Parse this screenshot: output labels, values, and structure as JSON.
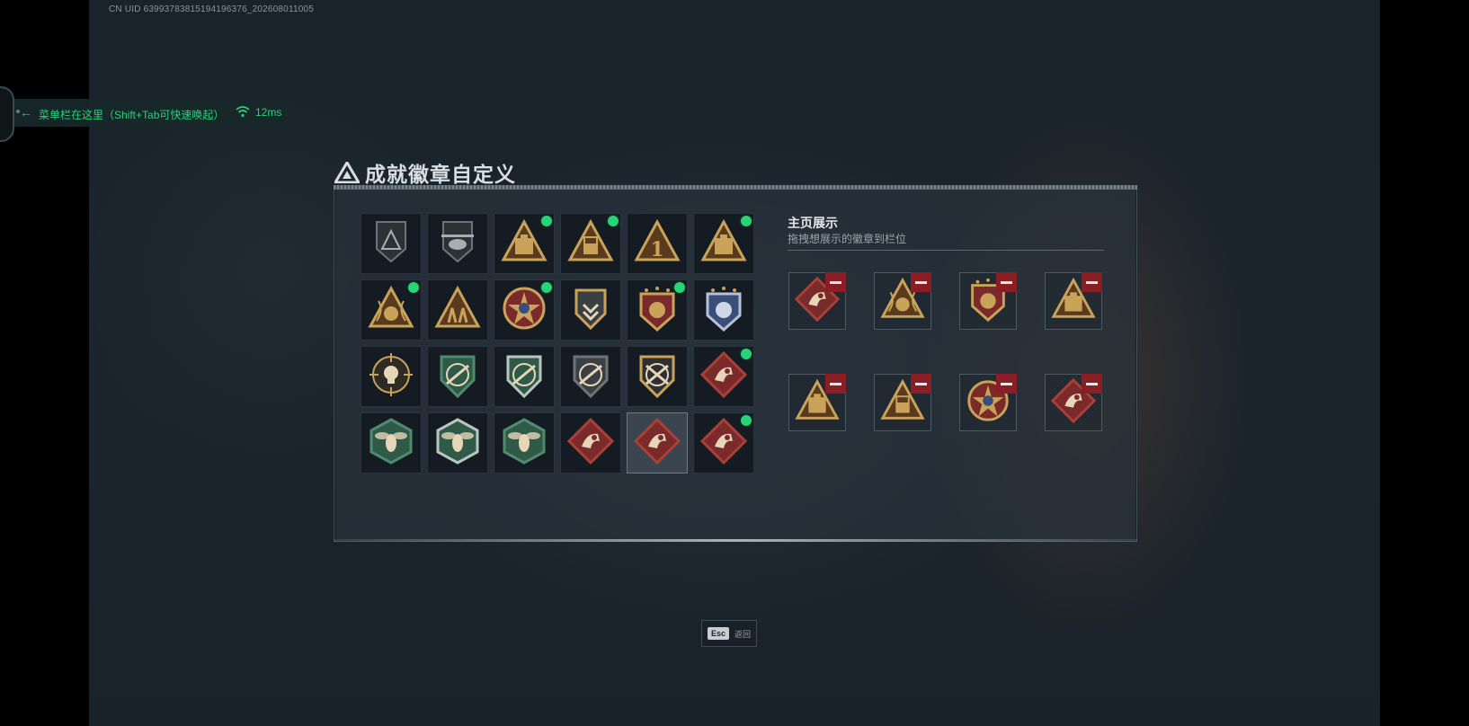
{
  "header": {
    "uid_text": "CN UID 6399378381519419637​6_202608011005"
  },
  "overlay_menu": {
    "hint_text": "菜单栏在这里（Shift+Tab可快速唤起）",
    "ping": "12ms",
    "accent_color": "#29d37a"
  },
  "page": {
    "title": "成就徽章自定义"
  },
  "badge_collection": {
    "rows": [
      [
        {
          "icon": "gray-triangle-shield-badge",
          "new": false
        },
        {
          "icon": "helicopter-badge",
          "new": false
        },
        {
          "icon": "gold-triangle-crate-badge",
          "new": true
        },
        {
          "icon": "gold-triangle-sr-badge",
          "new": true
        },
        {
          "icon": "gold-triangle-number-one-badge",
          "new": false
        },
        {
          "icon": "gold-triangle-box-badge",
          "new": true
        }
      ],
      [
        {
          "icon": "gold-triangle-wreath-badge",
          "new": true
        },
        {
          "icon": "gold-triangle-soldiers-badge",
          "new": false
        },
        {
          "icon": "red-star-emblem-badge",
          "new": true
        },
        {
          "icon": "gold-shield-chevron-badge",
          "new": false
        },
        {
          "icon": "red-crest-stars-badge",
          "new": true
        },
        {
          "icon": "blue-crest-lion-badge",
          "new": false
        }
      ],
      [
        {
          "icon": "skull-crosshair-badge",
          "new": false
        },
        {
          "icon": "green-shield-rifle-badge",
          "new": false
        },
        {
          "icon": "green-shield-rifle-silver-badge",
          "new": false
        },
        {
          "icon": "gray-shield-rifle-badge",
          "new": false
        },
        {
          "icon": "gold-shield-rifles-crossed-badge",
          "new": false
        },
        {
          "icon": "red-diamond-beast-badge",
          "new": true
        }
      ],
      [
        {
          "icon": "green-hex-wasp-badge",
          "new": false
        },
        {
          "icon": "green-hex-wasp-silver-badge",
          "new": false
        },
        {
          "icon": "green-hex-drone-badge",
          "new": false
        },
        {
          "icon": "red-diamond-dragon-badge",
          "new": false
        },
        {
          "icon": "red-diamond-dragon-selected-badge",
          "new": false,
          "selected": true
        },
        {
          "icon": "red-diamond-runner-badge",
          "new": true
        }
      ]
    ],
    "new_indicator_color": "#29d37a"
  },
  "showcase": {
    "title": "主页展示",
    "subtitle": "拖拽想展示的徽章到栏位",
    "slots": [
      {
        "icon": "red-diamond-beast-badge"
      },
      {
        "icon": "gold-triangle-wreath-badge"
      },
      {
        "icon": "red-crest-stars-badge"
      },
      {
        "icon": "gold-triangle-box-badge"
      },
      {
        "icon": "gold-triangle-crate-badge"
      },
      {
        "icon": "gold-triangle-sr-badge"
      },
      {
        "icon": "red-star-emblem-badge"
      },
      {
        "icon": "red-diamond-runner-badge"
      }
    ],
    "remove_color": "#8a1e24"
  },
  "footer": {
    "esc_key": "Esc",
    "esc_label": "返回"
  }
}
